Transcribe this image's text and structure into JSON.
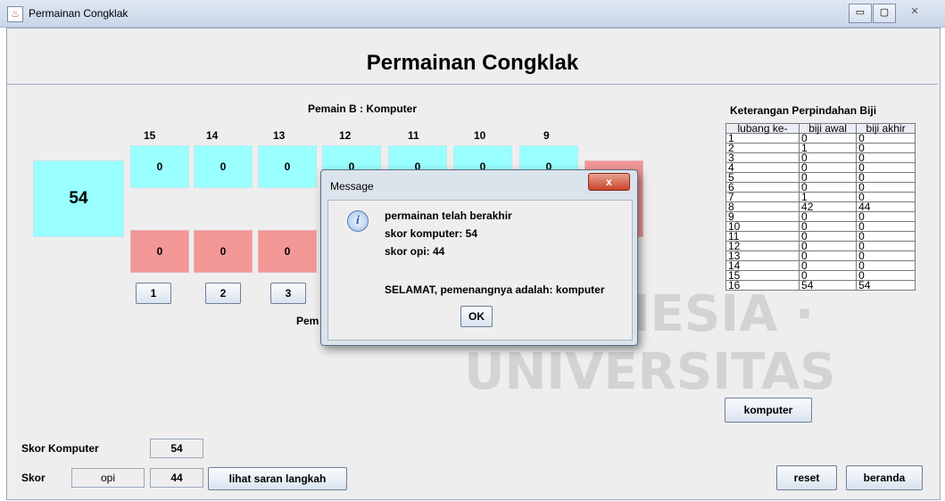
{
  "window": {
    "title": "Permainan Congklak",
    "minimize": "▭",
    "maximize": "▢",
    "close": "✕"
  },
  "header": {
    "title": "Permainan Congklak"
  },
  "board": {
    "player_b_label": "Pemain B : Komputer",
    "player_a_label": "Pem",
    "top_numbers": [
      "15",
      "14",
      "13",
      "12",
      "11",
      "10",
      "9"
    ],
    "top_values": [
      "0",
      "0",
      "0",
      "0",
      "0",
      "0",
      "0"
    ],
    "bottom_values": [
      "0",
      "0",
      "0"
    ],
    "bottom_buttons": [
      "1",
      "2",
      "3"
    ],
    "store_left": "54"
  },
  "scores": {
    "komputer_label": "Skor Komputer",
    "komputer_value": "54",
    "skor_label": "Skor",
    "player_name": "opi",
    "player_value": "44",
    "hint_button": "lihat saran langkah"
  },
  "side": {
    "title": "Keterangan Perpindahan Biji",
    "columns": [
      "lubang ke-",
      "biji awal",
      "biji akhir"
    ],
    "rows": [
      [
        "1",
        "0",
        "0"
      ],
      [
        "2",
        "1",
        "0"
      ],
      [
        "3",
        "0",
        "0"
      ],
      [
        "4",
        "0",
        "0"
      ],
      [
        "5",
        "0",
        "0"
      ],
      [
        "6",
        "0",
        "0"
      ],
      [
        "7",
        "1",
        "0"
      ],
      [
        "8",
        "42",
        "44"
      ],
      [
        "9",
        "0",
        "0"
      ],
      [
        "10",
        "0",
        "0"
      ],
      [
        "11",
        "0",
        "0"
      ],
      [
        "12",
        "0",
        "0"
      ],
      [
        "13",
        "0",
        "0"
      ],
      [
        "14",
        "0",
        "0"
      ],
      [
        "15",
        "0",
        "0"
      ],
      [
        "16",
        "54",
        "54"
      ]
    ],
    "komputer_button": "komputer",
    "reset_button": "reset",
    "beranda_button": "beranda"
  },
  "dialog": {
    "title": "Message",
    "close": "x",
    "line1": "permainan telah berakhir",
    "line2": "skor komputer: 54",
    "line3": "skor opi: 44",
    "line4": "SELAMAT, pemenangnya adalah: komputer",
    "ok": "OK",
    "info_glyph": "i"
  },
  "watermark": {
    "text": "ISLAM INDONESIA · UNIVERSITAS"
  }
}
